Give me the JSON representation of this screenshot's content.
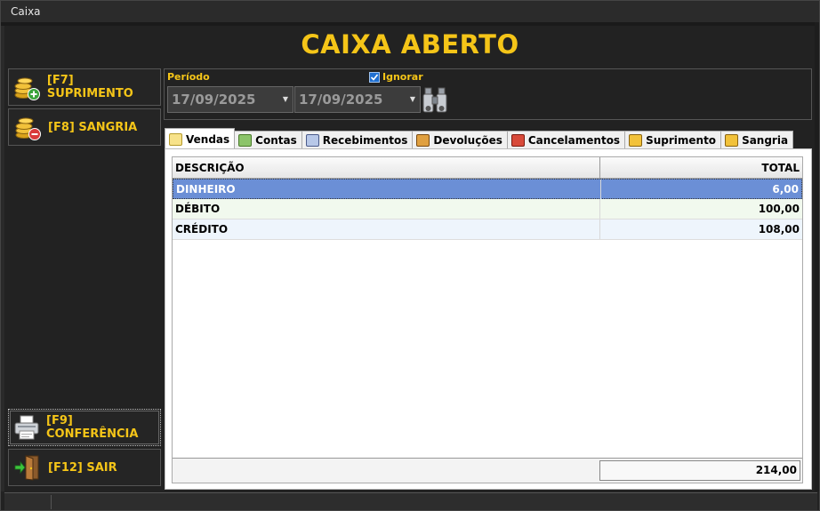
{
  "window": {
    "title": "Caixa"
  },
  "header": {
    "title": "CAIXA ABERTO"
  },
  "sidebar": {
    "suprimento_label": "[F7] SUPRIMENTO",
    "sangria_label": "[F8] SANGRIA",
    "conferencia_label": "[F9] CONFERÊNCIA",
    "sair_label": "[F12] SAIR"
  },
  "period": {
    "label": "Período",
    "start_date": "17/09/2025",
    "end_date": "17/09/2025",
    "ignore_label": "Ignorar",
    "ignore_checked": true
  },
  "tabs": [
    {
      "label": "Vendas",
      "active": true
    },
    {
      "label": "Contas"
    },
    {
      "label": "Recebimentos"
    },
    {
      "label": "Devoluções"
    },
    {
      "label": "Cancelamentos"
    },
    {
      "label": "Suprimento"
    },
    {
      "label": "Sangria"
    }
  ],
  "grid": {
    "columns": [
      "DESCRIÇÃO",
      "TOTAL"
    ],
    "rows": [
      {
        "descricao": "DINHEIRO",
        "total": "6,00"
      },
      {
        "descricao": "DÉBITO",
        "total": "100,00"
      },
      {
        "descricao": "CRÉDITO",
        "total": "108,00"
      }
    ],
    "footer_total": "214,00"
  },
  "colors": {
    "accent": "#f5c518",
    "selection": "#6b8fd6",
    "background": "#222222"
  }
}
